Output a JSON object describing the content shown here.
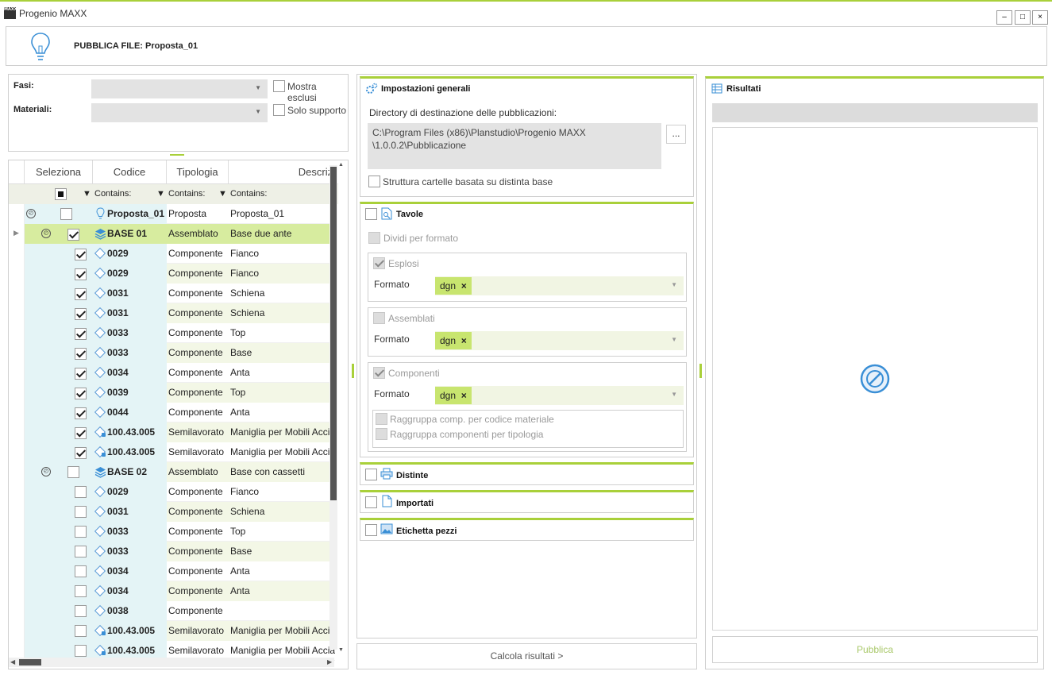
{
  "window": {
    "title": "Progenio MAXX",
    "logo_text": "MAXX",
    "minimize": "–",
    "maximize": "□",
    "close": "×"
  },
  "header": {
    "title": "PUBBLICA FILE: Proposta_01"
  },
  "filters": {
    "fasi_label": "Fasi:",
    "materiali_label": "Materiali:",
    "mostra_esclusi": "Mostra esclusi",
    "solo_supporto": "Solo supporto"
  },
  "grid": {
    "columns": [
      "Seleziona",
      "Codice",
      "Tipologia",
      "Descrizi"
    ],
    "filter_text": "Contains:",
    "rows": [
      {
        "code": "Proposta_01",
        "type": "Proposta",
        "desc": "Proposta_01",
        "checked": false,
        "level": 0,
        "expand": true,
        "icon": "bulb-icon",
        "highlight": false
      },
      {
        "code": "BASE 01",
        "type": "Assemblato",
        "desc": "Base due ante",
        "checked": true,
        "level": 1,
        "expand": true,
        "icon": "layers-icon",
        "highlight": true
      },
      {
        "code": "0029",
        "type": "Componente",
        "desc": "Fianco",
        "checked": true,
        "level": 2,
        "icon": "diamond-icon"
      },
      {
        "code": "0029",
        "type": "Componente",
        "desc": "Fianco",
        "checked": true,
        "level": 2,
        "icon": "diamond-icon"
      },
      {
        "code": "0031",
        "type": "Componente",
        "desc": "Schiena",
        "checked": true,
        "level": 2,
        "icon": "diamond-icon"
      },
      {
        "code": "0031",
        "type": "Componente",
        "desc": "Schiena",
        "checked": true,
        "level": 2,
        "icon": "diamond-icon"
      },
      {
        "code": "0033",
        "type": "Componente",
        "desc": "Top",
        "checked": true,
        "level": 2,
        "icon": "diamond-icon"
      },
      {
        "code": "0033",
        "type": "Componente",
        "desc": "Base",
        "checked": true,
        "level": 2,
        "icon": "diamond-icon"
      },
      {
        "code": "0034",
        "type": "Componente",
        "desc": "Anta",
        "checked": true,
        "level": 2,
        "icon": "diamond-icon"
      },
      {
        "code": "0039",
        "type": "Componente",
        "desc": "Top",
        "checked": true,
        "level": 2,
        "icon": "diamond-icon"
      },
      {
        "code": "0044",
        "type": "Componente",
        "desc": "Anta",
        "checked": true,
        "level": 2,
        "icon": "diamond-icon"
      },
      {
        "code": "100.43.005",
        "type": "Semilavorato",
        "desc": "Maniglia per Mobili Accia",
        "checked": true,
        "level": 2,
        "icon": "semi-icon"
      },
      {
        "code": "100.43.005",
        "type": "Semilavorato",
        "desc": "Maniglia per Mobili Accia",
        "checked": true,
        "level": 2,
        "icon": "semi-icon"
      },
      {
        "code": "BASE 02",
        "type": "Assemblato",
        "desc": "Base con cassetti",
        "checked": false,
        "level": 1,
        "expand": true,
        "icon": "layers-icon"
      },
      {
        "code": "0029",
        "type": "Componente",
        "desc": "Fianco",
        "checked": false,
        "level": 2,
        "icon": "diamond-icon"
      },
      {
        "code": "0031",
        "type": "Componente",
        "desc": "Schiena",
        "checked": false,
        "level": 2,
        "icon": "diamond-icon"
      },
      {
        "code": "0033",
        "type": "Componente",
        "desc": "Top",
        "checked": false,
        "level": 2,
        "icon": "diamond-icon"
      },
      {
        "code": "0033",
        "type": "Componente",
        "desc": "Base",
        "checked": false,
        "level": 2,
        "icon": "diamond-icon"
      },
      {
        "code": "0034",
        "type": "Componente",
        "desc": "Anta",
        "checked": false,
        "level": 2,
        "icon": "diamond-icon"
      },
      {
        "code": "0034",
        "type": "Componente",
        "desc": "Anta",
        "checked": false,
        "level": 2,
        "icon": "diamond-icon"
      },
      {
        "code": "0038",
        "type": "Componente",
        "desc": "",
        "checked": false,
        "level": 2,
        "icon": "diamond-icon"
      },
      {
        "code": "100.43.005",
        "type": "Semilavorato",
        "desc": "Maniglia per Mobili Accia",
        "checked": false,
        "level": 2,
        "icon": "semi-icon"
      },
      {
        "code": "100.43.005",
        "type": "Semilavorato",
        "desc": "Maniglia per Mobili Accia",
        "checked": false,
        "level": 2,
        "icon": "semi-icon"
      }
    ]
  },
  "settings": {
    "title": "Impostazioni generali",
    "dir_label": "Directory di destinazione delle pubblicazioni:",
    "dir_line1": "C:\\Program Files (x86)\\Planstudio\\Progenio MAXX",
    "dir_line2": "\\1.0.0.2\\Pubblicazione",
    "browse": "...",
    "struttura": "Struttura cartelle basata su distinta base"
  },
  "tavole": {
    "title": "Tavole",
    "dividi": "Dividi per formato",
    "formato_label": "Formato",
    "esplosi": "Esplosi",
    "assemblati": "Assemblati",
    "componenti": "Componenti",
    "tag": "dgn",
    "tag_remove": "×",
    "raggruppa1": "Raggruppa comp. per codice materiale",
    "raggruppa2": "Raggruppa componenti per tipologia"
  },
  "sections": {
    "distinte": "Distinte",
    "importati": "Importati",
    "etichetta": "Etichetta pezzi"
  },
  "calc_button": "Calcola risultati >",
  "results": {
    "title": "Risultati",
    "publish": "Pubblica"
  },
  "colors": {
    "accent": "#a9d03a",
    "highlight": "#d7ec9f",
    "selcol": "#e4f4f6"
  }
}
